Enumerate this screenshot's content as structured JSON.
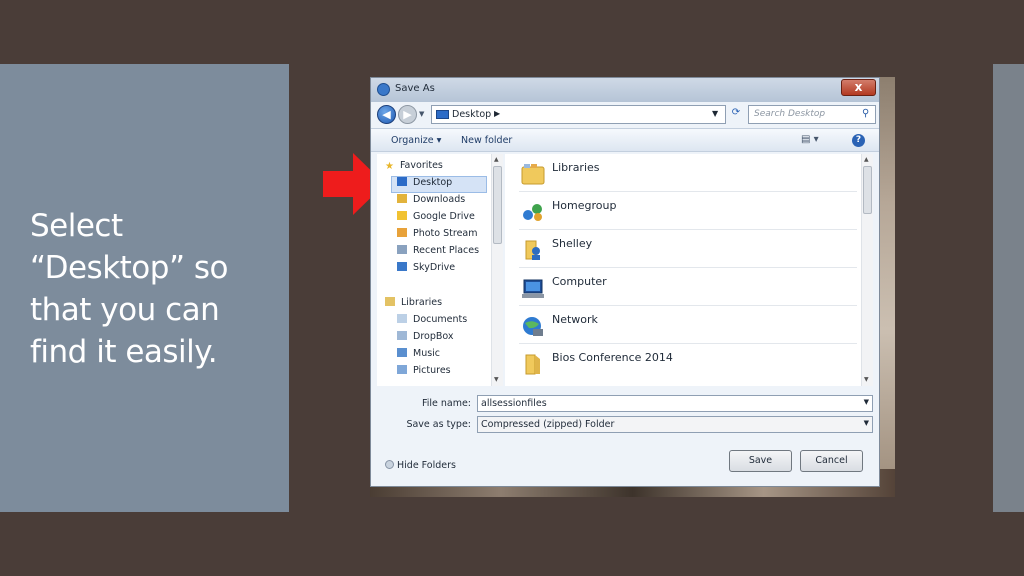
{
  "slide": {
    "caption_lines": [
      "Select",
      "“Desktop” so",
      "that you can",
      "find it easily."
    ]
  },
  "dialog": {
    "title": "Save As",
    "close_label": "x",
    "address": {
      "location": "Desktop"
    },
    "search_placeholder": "Search Desktop",
    "toolbar": {
      "organize": "Organize ▾",
      "new_folder": "New folder"
    },
    "nav": {
      "favorites_header": "Favorites",
      "favorites": [
        "Desktop",
        "Downloads",
        "Google Drive",
        "Photo Stream",
        "Recent Places",
        "SkyDrive"
      ],
      "libraries_header": "Libraries",
      "libraries": [
        "Documents",
        "DropBox",
        "Music",
        "Pictures"
      ],
      "selected": "Desktop"
    },
    "items": [
      "Libraries",
      "Homegroup",
      "Shelley",
      "Computer",
      "Network",
      "Bios Conference 2014"
    ],
    "file_name_label": "File name:",
    "file_name_value": "allsessionfiles",
    "save_type_label": "Save as type:",
    "save_type_value": "Compressed (zipped) Folder",
    "hide_folders_label": "Hide Folders",
    "save_label": "Save",
    "cancel_label": "Cancel"
  },
  "colors": {
    "arrow": "#ee1c1c",
    "slide_bg": "#4a3d38",
    "panel": "#7d8c9c"
  }
}
